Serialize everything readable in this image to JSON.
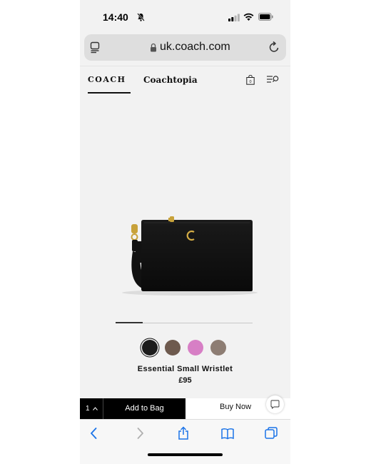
{
  "status_bar": {
    "time": "14:40"
  },
  "browser": {
    "url": "uk.coach.com"
  },
  "site_nav": {
    "brand": "COACH",
    "sub_brand": "Coachtopia"
  },
  "product": {
    "name": "Essential Small Wristlet",
    "price": "£95",
    "carousel_progress": 0.2,
    "swatches": [
      {
        "color": "#1c1c1c",
        "selected": true
      },
      {
        "color": "#6e5a4e",
        "selected": false
      },
      {
        "color": "#d77fc5",
        "selected": false
      },
      {
        "color": "#8d7d73",
        "selected": false
      }
    ]
  },
  "purchase_bar": {
    "quantity": "1",
    "add_to_bag": "Add to Bag",
    "buy_now": "Buy Now"
  },
  "colors": {
    "accent": "#000000",
    "background": "#f2f2f2",
    "link_blue": "#1a73e8"
  },
  "icons": [
    "bell-slash-icon",
    "signal-icon",
    "wifi-icon",
    "battery-icon",
    "tabs-icon",
    "lock-icon",
    "reload-icon",
    "shopping-bag-icon",
    "search-menu-icon",
    "chevron-up-icon",
    "chat-icon",
    "back-icon",
    "forward-icon",
    "share-icon",
    "bookmarks-icon",
    "tabs-overview-icon"
  ]
}
